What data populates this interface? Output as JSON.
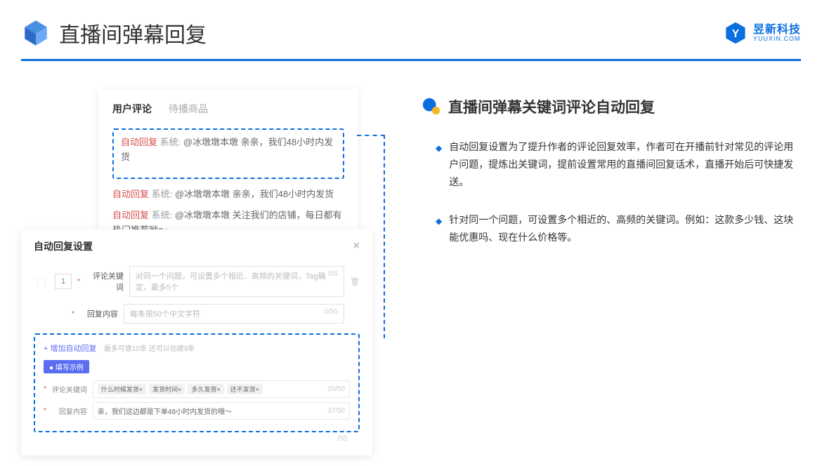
{
  "header": {
    "title": "直播间弹幕回复",
    "brand_name": "昱新科技",
    "brand_url": "YUUXIN.COM"
  },
  "comments": {
    "tab1": "用户评论",
    "tab2": "待播商品",
    "hl_tag": "自动回复",
    "hl_sys": " 系统: ",
    "hl_text": "@冰墩墩本墩 亲亲，我们48小时内发货",
    "row2_tag": "自动回复",
    "row2_sys": " 系统: ",
    "row2_text": "@冰墩墩本墩 亲亲，我们48小时内发货",
    "row3_tag": "自动回复",
    "row3_sys": " 系统: ",
    "row3_text": "@冰墩墩本墩 关注我们的店铺，每日都有热门推荐呦～"
  },
  "settings": {
    "title": "自动回复设置",
    "num": "1",
    "label1": "评论关键词",
    "placeholder1": "对同一个问题，可设置多个相近、高频的关键词，Tag确定，最多5个",
    "count1": "0/5",
    "label2": "回复内容",
    "placeholder2": "每条限50个中文字符",
    "count2": "0/50",
    "add_link": "+ 增加自动回复",
    "add_hint": "最多可建10条 还可以创建9条",
    "example_badge": "● 填写示例",
    "ex_label1": "评论关键词",
    "ex_tag1": "什么时候发货×",
    "ex_tag2": "发货时间×",
    "ex_tag3": "多久发货×",
    "ex_tag4": "还不发货×",
    "ex_count1": "20/50",
    "ex_label2": "回复内容",
    "ex_text2": "亲，我们这边都是下单48小时内发货的哦～",
    "ex_count2": "37/50",
    "below_count": "/50"
  },
  "right": {
    "section_title": "直播间弹幕关键词评论自动回复",
    "bullets": [
      "自动回复设置为了提升作者的评论回复效率，作者可在开播前针对常见的评论用户问题，提炼出关键词，提前设置常用的直播间回复话术，直播开始后可快捷发送。",
      "针对同一个问题，可设置多个相近的、高频的关键词。例如：这款多少钱、这块能优惠吗、现在什么价格等。"
    ]
  }
}
